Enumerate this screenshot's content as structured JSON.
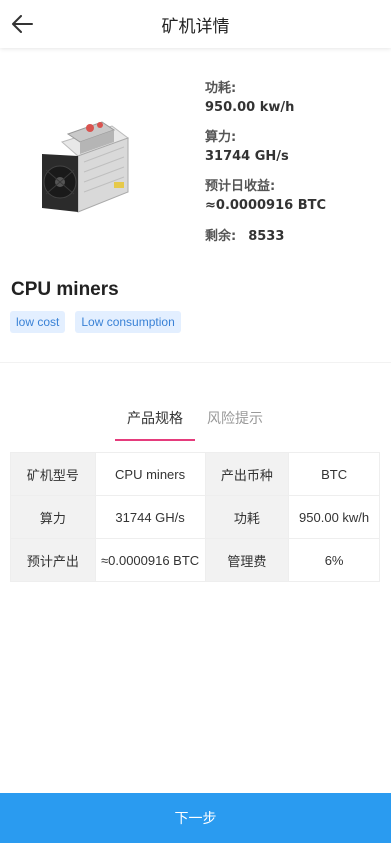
{
  "header": {
    "title": "矿机详情",
    "back_icon": "arrow-left-icon"
  },
  "product": {
    "image_icon": "asic-miner-icon",
    "specs": {
      "power_label": "功耗:",
      "power_value": "950.00 kw/h",
      "hashrate_label": "算力:",
      "hashrate_value": "31744 GH/s",
      "daily_income_label": "预计日收益:",
      "daily_income_value": "≈0.0000916 BTC",
      "remaining_label": "剩余:",
      "remaining_value": "8533"
    },
    "name": "CPU miners",
    "tags": [
      "low cost",
      "Low consumption"
    ]
  },
  "tabs": [
    {
      "label": "产品规格",
      "active": true
    },
    {
      "label": "风险提示",
      "active": false
    }
  ],
  "spec_table": [
    [
      "矿机型号",
      "CPU miners",
      "产出币种",
      "BTC"
    ],
    [
      "算力",
      "31744 GH/s",
      "功耗",
      "950.00 kw/h"
    ],
    [
      "预计产出",
      "≈0.0000916 BTC",
      "管理费",
      "6%"
    ]
  ],
  "footer": {
    "next_label": "下一步"
  },
  "colors": {
    "accent": "#2a9bf0",
    "tab_underline": "#e53b7c",
    "tag_bg": "#e3efff",
    "tag_text": "#3a82d6"
  }
}
